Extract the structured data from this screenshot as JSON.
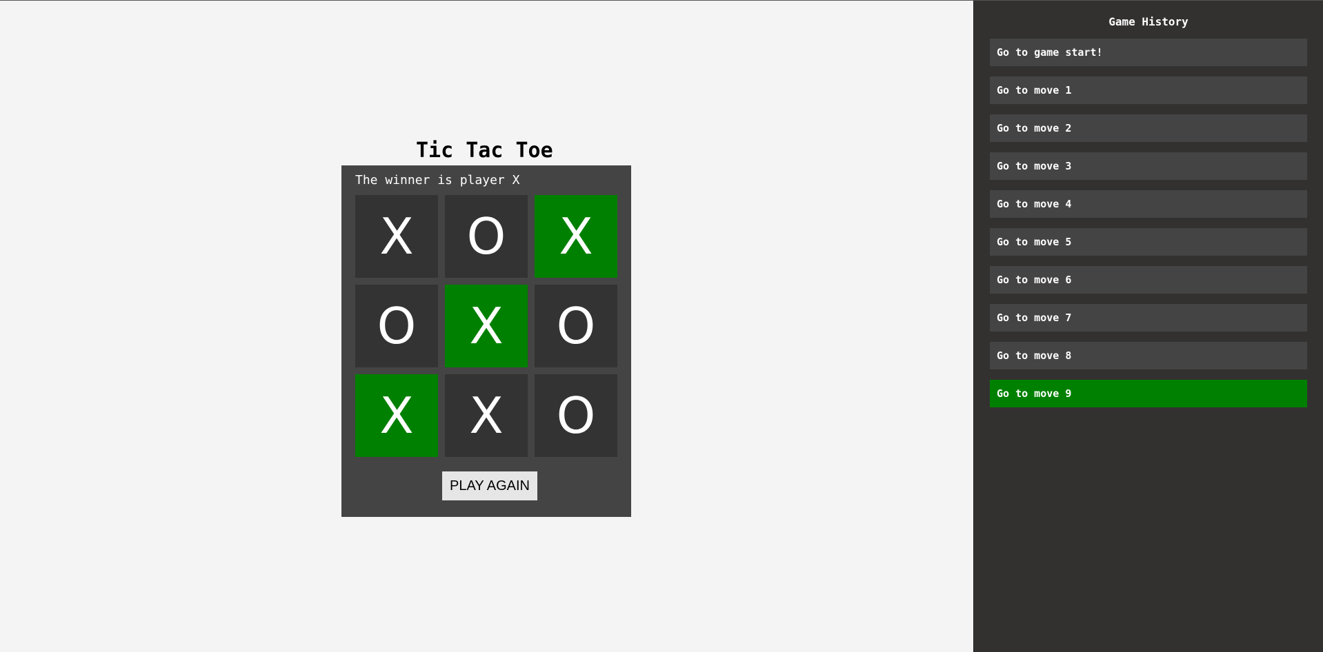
{
  "game": {
    "title": "Tic Tac Toe",
    "status": "The winner is player X",
    "board": [
      "X",
      "O",
      "X",
      "O",
      "X",
      "O",
      "X",
      "X",
      "O"
    ],
    "winning_cells": [
      2,
      4,
      6
    ],
    "play_again_label": "PLAY AGAIN"
  },
  "history": {
    "title": "Game History",
    "items": [
      "Go to game start!",
      "Go to move 1",
      "Go to move 2",
      "Go to move 3",
      "Go to move 4",
      "Go to move 5",
      "Go to move 6",
      "Go to move 7",
      "Go to move 8",
      "Go to move 9"
    ],
    "active_index": 9
  },
  "colors": {
    "page_background": "#f4f4f4",
    "panel_background": "#444444",
    "cell_background": "#333333",
    "win_highlight": "#008000",
    "sidebar_background": "#323130",
    "button_background": "#e6e6e6"
  }
}
